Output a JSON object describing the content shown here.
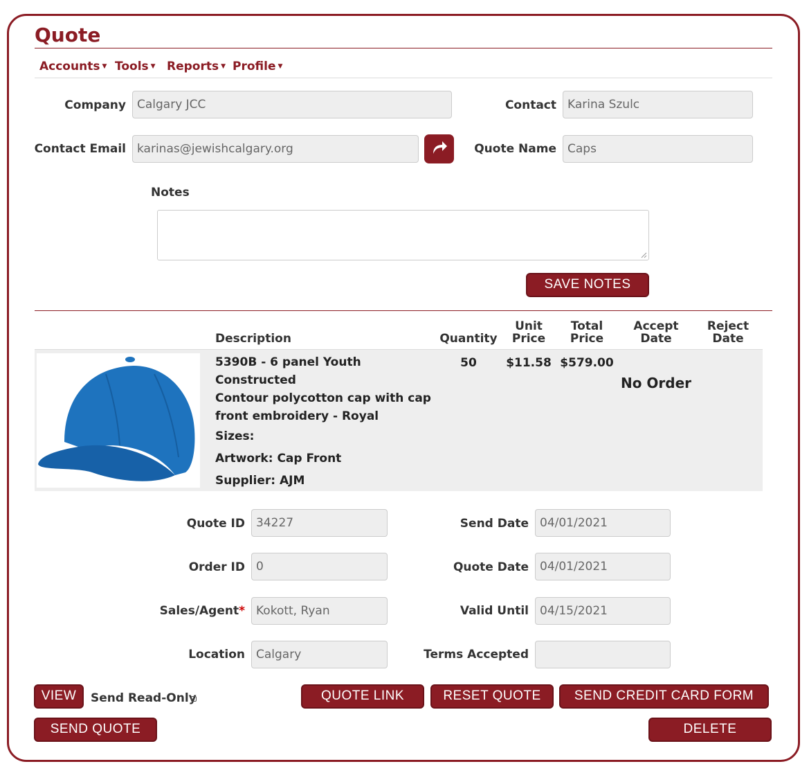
{
  "page": {
    "title": "Quote"
  },
  "nav": [
    {
      "label": "Accounts"
    },
    {
      "label": "Tools"
    },
    {
      "label": "Reports"
    },
    {
      "label": "Profile"
    }
  ],
  "form": {
    "company_label": "Company",
    "company_value": "Calgary JCC",
    "contact_label": "Contact",
    "contact_value": "Karina Szulc",
    "email_label": "Contact Email",
    "email_value": "karinas@jewishcalgary.org",
    "quote_name_label": "Quote Name",
    "quote_name_value": "Caps",
    "notes_label": "Notes",
    "notes_value": "",
    "save_notes_label": "SAVE NOTES"
  },
  "table": {
    "headers": {
      "description": "Description",
      "quantity": "Quantity",
      "unit_price_1": "Unit",
      "unit_price_2": "Price",
      "total_price_1": "Total",
      "total_price_2": "Price",
      "accept_date_1": "Accept",
      "accept_date_2": "Date",
      "reject_date_1": "Reject",
      "reject_date_2": "Date"
    },
    "item": {
      "desc_line1": "5390B - 6 panel Youth Constructed",
      "desc_line2": "Contour polycotton cap with cap",
      "desc_line3": "front embroidery - Royal",
      "sizes": "Sizes:",
      "artwork": "Artwork:  Cap Front",
      "supplier": "Supplier: AJM",
      "quantity": "50",
      "unit_price": "$11.58",
      "total_price": "$579.00",
      "status": "No Order",
      "image_color": "#1e73be"
    }
  },
  "details": {
    "quote_id_label": "Quote ID",
    "quote_id_value": "34227",
    "order_id_label": "Order ID",
    "order_id_value": "0",
    "sales_agent_label": "Sales/Agent",
    "sales_agent_required": "*",
    "sales_agent_value": "Kokott, Ryan",
    "location_label": "Location",
    "location_value": "Calgary",
    "send_date_label": "Send Date",
    "send_date_value": "04/01/2021",
    "quote_date_label": "Quote Date",
    "quote_date_value": "04/01/2021",
    "valid_until_label": "Valid Until",
    "valid_until_value": "04/15/2021",
    "terms_accepted_label": "Terms Accepted",
    "terms_accepted_value": ""
  },
  "actions": {
    "view": "VIEW",
    "send_read_only": "Send Read-Only",
    "quote_link": "QUOTE LINK",
    "reset_quote": "RESET QUOTE",
    "send_credit_card_form": "SEND CREDIT CARD FORM",
    "send_quote": "SEND QUOTE",
    "delete": "DELETE"
  },
  "colors": {
    "brand": "#8b1c24",
    "field_bg": "#eeeeee",
    "item_bg": "#eeeeee"
  }
}
